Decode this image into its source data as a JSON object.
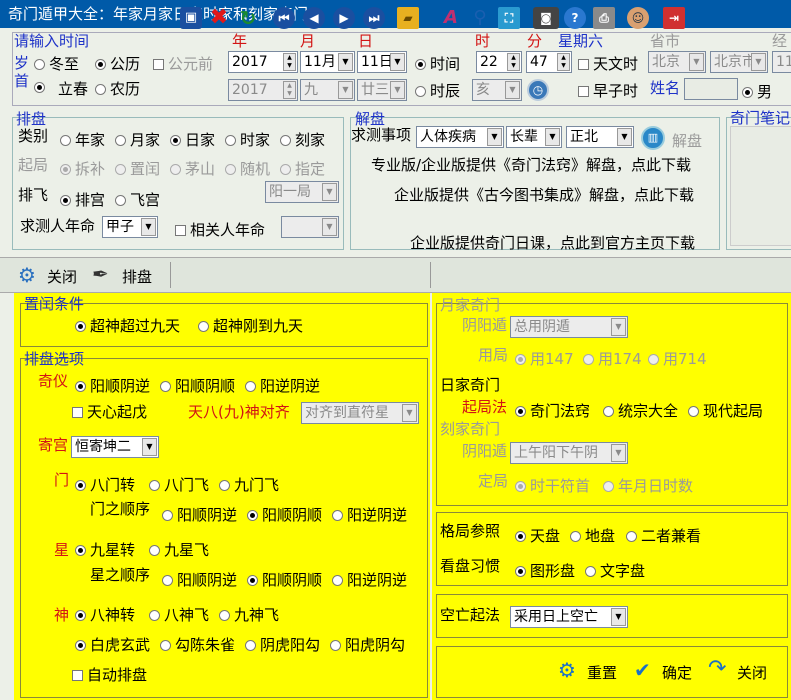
{
  "window": {
    "title": "奇门遁甲大全：年家月家日家时家和刻家奇门"
  },
  "time_input": {
    "header": "请输入时间",
    "col_year": "年",
    "col_month": "月",
    "col_day": "日",
    "col_hour": "时",
    "col_minute": "分",
    "weekday": "星期六",
    "col_province": "省市",
    "col_lng": "经",
    "row1_left": "岁",
    "row2_left": "首",
    "opt_dongzhi": "冬至",
    "opt_gongli": "公历",
    "opt_gongyuanqian": "公元前",
    "opt_lichun": "立春",
    "opt_nongli": "农历",
    "year_val": "2017",
    "month_val": "11月",
    "day_val": "11日",
    "opt_shijian": "时间",
    "hour_val": "22",
    "minute_val": "47",
    "opt_tianwenshi": "天文时",
    "province_val": "北京",
    "city_val": "北京市",
    "lng_val": "11",
    "lunar_year": "2017",
    "lunar_month": "九",
    "lunar_day": "廿三",
    "opt_shichen": "时辰",
    "shichen_val": "亥",
    "opt_zaozishi": "早子时",
    "name_label": "姓名",
    "name_val": "",
    "gender_male": "男"
  },
  "paipan": {
    "header": "排盘",
    "leibie_label": "类别",
    "opts": [
      "年家",
      "月家",
      "日家",
      "时家",
      "刻家"
    ],
    "qiju_label": "起局",
    "qiju_opts": [
      "拆补",
      "置闰",
      "茅山",
      "随机",
      "指定"
    ],
    "paifei_label": "排飞",
    "paifei_opts": [
      "排宫",
      "飞宫"
    ],
    "ju_val": "阳一局",
    "nianming_label": "求测人年命",
    "nianming_val": "甲子",
    "xiangguan_label": "相关人年命",
    "xiangguan_val": ""
  },
  "jiepan": {
    "header": "解盘",
    "shixiang_label": "求测事项",
    "shixiang_val": "人体疾病",
    "zhangbei_val": "长辈",
    "direction_val": "正北",
    "jiepan_btn": "解盘",
    "line1": "专业版/企业版提供《奇门法窍》解盘，点此下载",
    "line2": "企业版提供《古今图书集成》解盘，点此下载",
    "line3": "企业版提供奇门日课，点此到官方主页下载"
  },
  "notes": {
    "header": "奇门笔记"
  },
  "toolbar": {
    "close": "关闭",
    "paipan": "排盘"
  },
  "zhirun": {
    "header": "置闰条件",
    "opt1": "超神超过九天",
    "opt2": "超神刚到九天"
  },
  "paipan_opts": {
    "header": "排盘选项",
    "qiyi_label": "奇仪",
    "qiyi_opts": [
      "阳顺阴逆",
      "阳顺阴顺",
      "阳逆阴逆"
    ],
    "tianxin": "天心起戊",
    "tianba_label": "天八(九)神对齐",
    "tianba_val": "对齐到直符星",
    "jigong_label": "寄宫",
    "jigong_val": "恒寄坤二",
    "men_label": "门",
    "men_opts": [
      "八门转",
      "八门飞",
      "九门飞"
    ],
    "men_order_label": "门之顺序",
    "men_order_opts": [
      "阳顺阴逆",
      "阳顺阴顺",
      "阳逆阴逆"
    ],
    "xing_label": "星",
    "xing_opts": [
      "九星转",
      "九星飞"
    ],
    "xing_order_label": "星之顺序",
    "xing_order_opts": [
      "阳顺阴逆",
      "阳顺阴顺",
      "阳逆阴逆"
    ],
    "shen_label": "神",
    "shen_opts": [
      "八神转",
      "八神飞",
      "九神飞"
    ],
    "shen_opts2": [
      "白虎玄武",
      "勾陈朱雀",
      "阴虎阳勾",
      "阳虎阴勾"
    ],
    "auto": "自动排盘"
  },
  "yuejia": {
    "header": "月家奇门",
    "yindun_label": "阴阳遁",
    "yindun_val": "总用阴遁",
    "yongju_label": "用局",
    "yongju_opts": [
      "用147",
      "用174",
      "用714"
    ]
  },
  "rijia": {
    "header": "日家奇门",
    "qiju_label": "起局法",
    "qiju_opts": [
      "奇门法窍",
      "统宗大全",
      "现代起局"
    ]
  },
  "kejia": {
    "header": "刻家奇门",
    "yindun_label": "阴阳遁",
    "yindun_val": "上午阳下午阴",
    "dingju_label": "定局",
    "dingju_opts": [
      "时干符首",
      "年月日时数"
    ]
  },
  "geju": {
    "label": "格局参照",
    "opts": [
      "天盘",
      "地盘",
      "二者兼看"
    ]
  },
  "kanpan": {
    "label": "看盘习惯",
    "opts": [
      "图形盘",
      "文字盘"
    ]
  },
  "kongwang": {
    "label": "空亡起法",
    "val": "采用日上空亡"
  },
  "buttons": {
    "reset": "重置",
    "ok": "确定",
    "close": "关闭"
  }
}
